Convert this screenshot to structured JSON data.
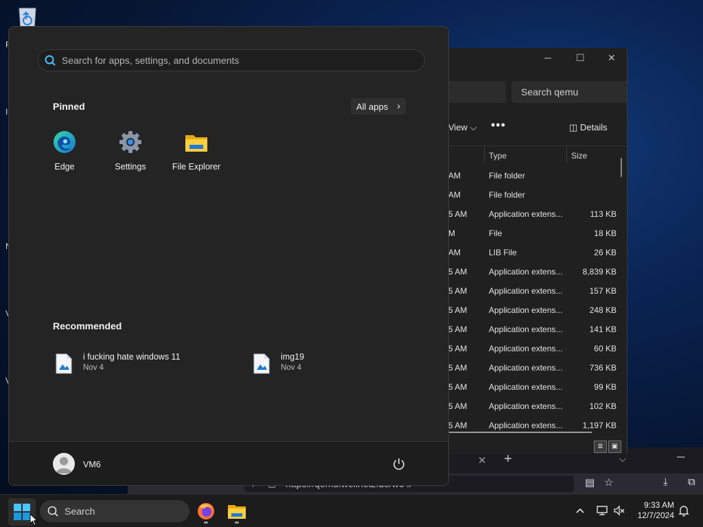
{
  "start_menu": {
    "search_placeholder": "Search for apps, settings, and documents",
    "pinned_title": "Pinned",
    "all_apps_label": "All apps",
    "pinned_apps": [
      {
        "label": "Edge",
        "icon": "edge-icon"
      },
      {
        "label": "Settings",
        "icon": "settings-gear-icon"
      },
      {
        "label": "File Explorer",
        "icon": "folder-icon"
      }
    ],
    "recommended_title": "Recommended",
    "recommended": [
      {
        "name": "i fucking hate windows 11",
        "date": "Nov 4",
        "icon": "image-file-icon"
      },
      {
        "name": "img19",
        "date": "Nov 4",
        "icon": "image-file-icon"
      }
    ],
    "user_name": "VM6"
  },
  "file_explorer": {
    "search_placeholder": "Search qemu",
    "toolbar": {
      "view_label": "View",
      "more_label": "•••",
      "details_label": "Details"
    },
    "columns": {
      "type": "Type",
      "size": "Size"
    },
    "rows": [
      {
        "date": "AM",
        "type": "File folder",
        "size": ""
      },
      {
        "date": "AM",
        "type": "File folder",
        "size": ""
      },
      {
        "date": "5 AM",
        "type": "Application extens...",
        "size": "113 KB"
      },
      {
        "date": "M",
        "type": "File",
        "size": "18 KB"
      },
      {
        "date": "AM",
        "type": "LIB File",
        "size": "26 KB"
      },
      {
        "date": "5 AM",
        "type": "Application extens...",
        "size": "8,839 KB"
      },
      {
        "date": "5 AM",
        "type": "Application extens...",
        "size": "157 KB"
      },
      {
        "date": "5 AM",
        "type": "Application extens...",
        "size": "248 KB"
      },
      {
        "date": "5 AM",
        "type": "Application extens...",
        "size": "141 KB"
      },
      {
        "date": "5 AM",
        "type": "Application extens...",
        "size": "60 KB"
      },
      {
        "date": "5 AM",
        "type": "Application extens...",
        "size": "736 KB"
      },
      {
        "date": "5 AM",
        "type": "Application extens...",
        "size": "99 KB"
      },
      {
        "date": "5 AM",
        "type": "Application extens...",
        "size": "102 KB"
      },
      {
        "date": "5 AM",
        "type": "Application extens...",
        "size": "1,197 KB"
      }
    ]
  },
  "browser": {
    "url": "https://qemu.weilnetz.de/w64/"
  },
  "taskbar": {
    "search_label": "Search",
    "time": "9:33 AM",
    "date": "12/7/2024"
  },
  "desktop": {
    "edge_fragments": [
      "R",
      "I",
      "N",
      "V",
      "V"
    ]
  },
  "colors": {
    "accent": "#0078d4",
    "start_bg": "#242424",
    "taskbar_bg": "#1c1c1c"
  }
}
